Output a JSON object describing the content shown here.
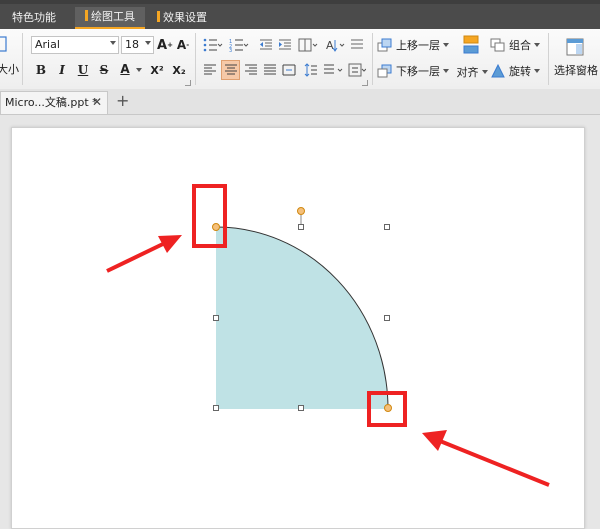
{
  "tabs": [
    {
      "label": "特色功能",
      "active": false
    },
    {
      "label": "绘图工具",
      "active": true
    },
    {
      "label": "效果设置",
      "active": false
    }
  ],
  "ribbon": {
    "size_label": "大小",
    "font_name": "Arial",
    "font_size": "18",
    "format_buttons": [
      "B",
      "I",
      "U",
      "S",
      "A",
      "X²",
      "X₂"
    ],
    "move_up_label": "上移一层",
    "move_down_label": "下移一层",
    "group_label": "组合",
    "align_label": "对齐",
    "rotate_label": "旋转",
    "selection_pane_label": "选择窗格"
  },
  "document": {
    "tab_label": "Micro...文稿.ppt *",
    "close_glyph": "✕",
    "new_tab_glyph": "+"
  },
  "colors": {
    "shape_fill": "#bfe2e5",
    "highlight_red": "#ee2222",
    "adjust_handle": "#f5a623",
    "accent": "#f5a623"
  },
  "icons": [
    "font-grow-icon",
    "font-shrink-icon",
    "bullets-icon",
    "numbering-icon",
    "indent-icon",
    "line-spacing-icon",
    "bring-forward-icon",
    "send-backward-icon",
    "group-icon",
    "selection-pane-icon",
    "close-icon",
    "plus-icon",
    "arrow-icon"
  ]
}
